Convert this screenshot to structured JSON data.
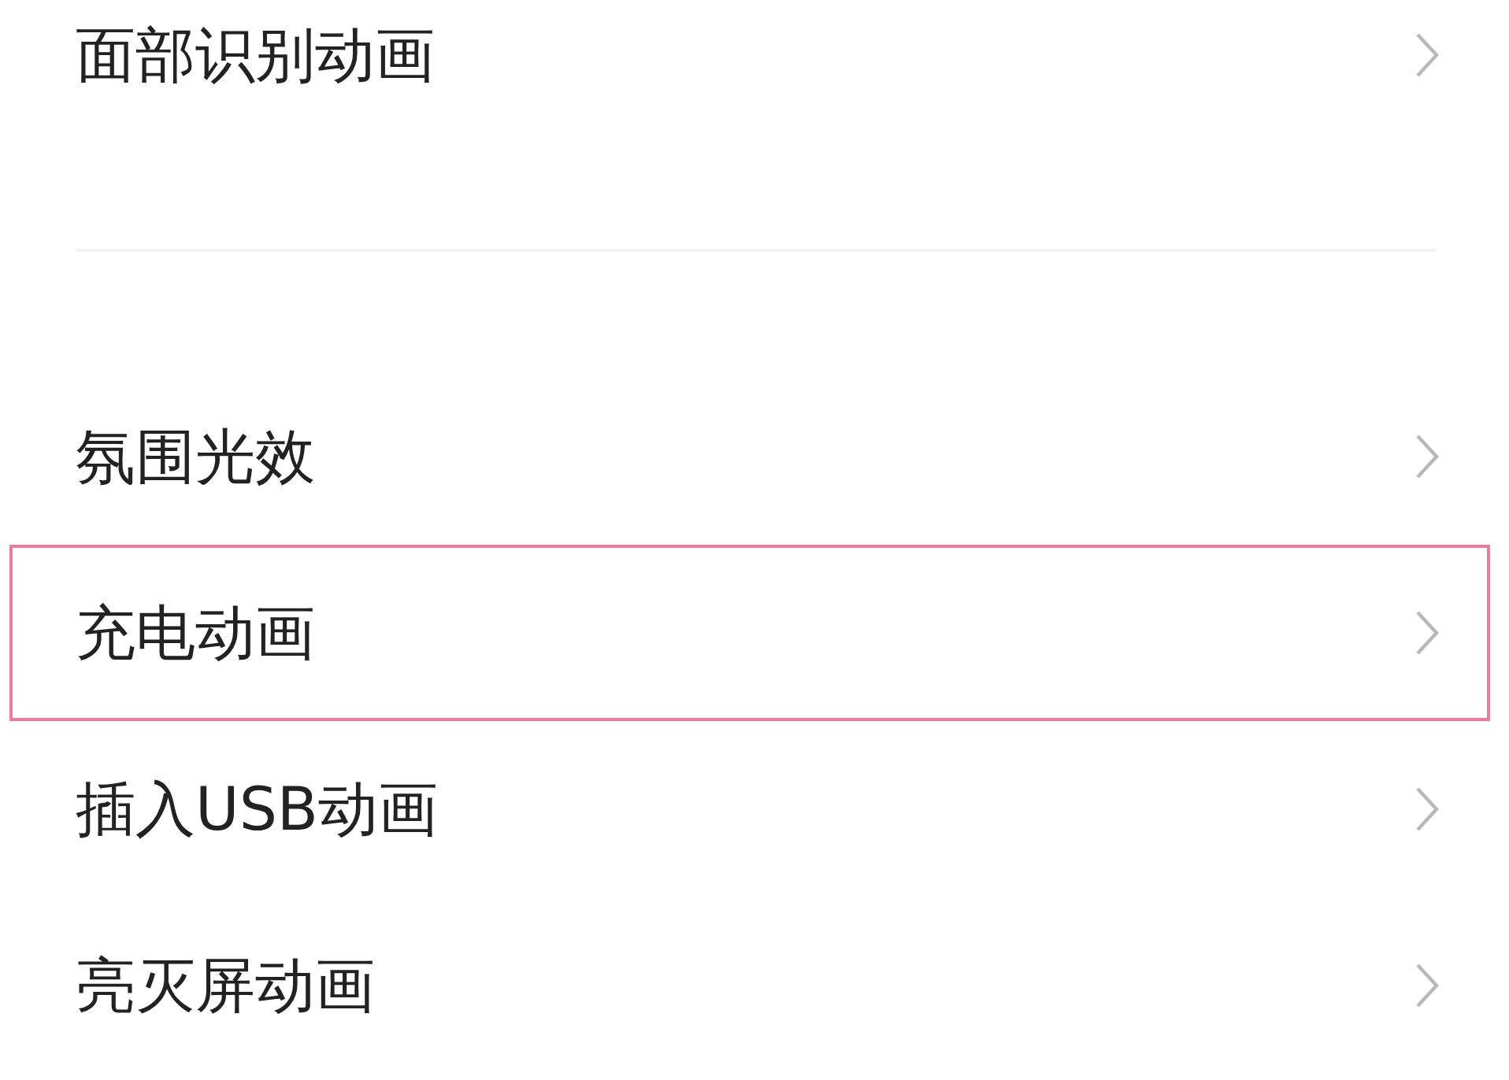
{
  "sections": [
    {
      "items": [
        {
          "label": "面部识别动画",
          "highlighted": false
        }
      ]
    },
    {
      "items": [
        {
          "label": "氛围光效",
          "highlighted": false
        },
        {
          "label": "充电动画",
          "highlighted": true
        },
        {
          "label": "插入USB动画",
          "highlighted": false
        },
        {
          "label": "亮灭屏动画",
          "highlighted": false
        }
      ]
    }
  ]
}
